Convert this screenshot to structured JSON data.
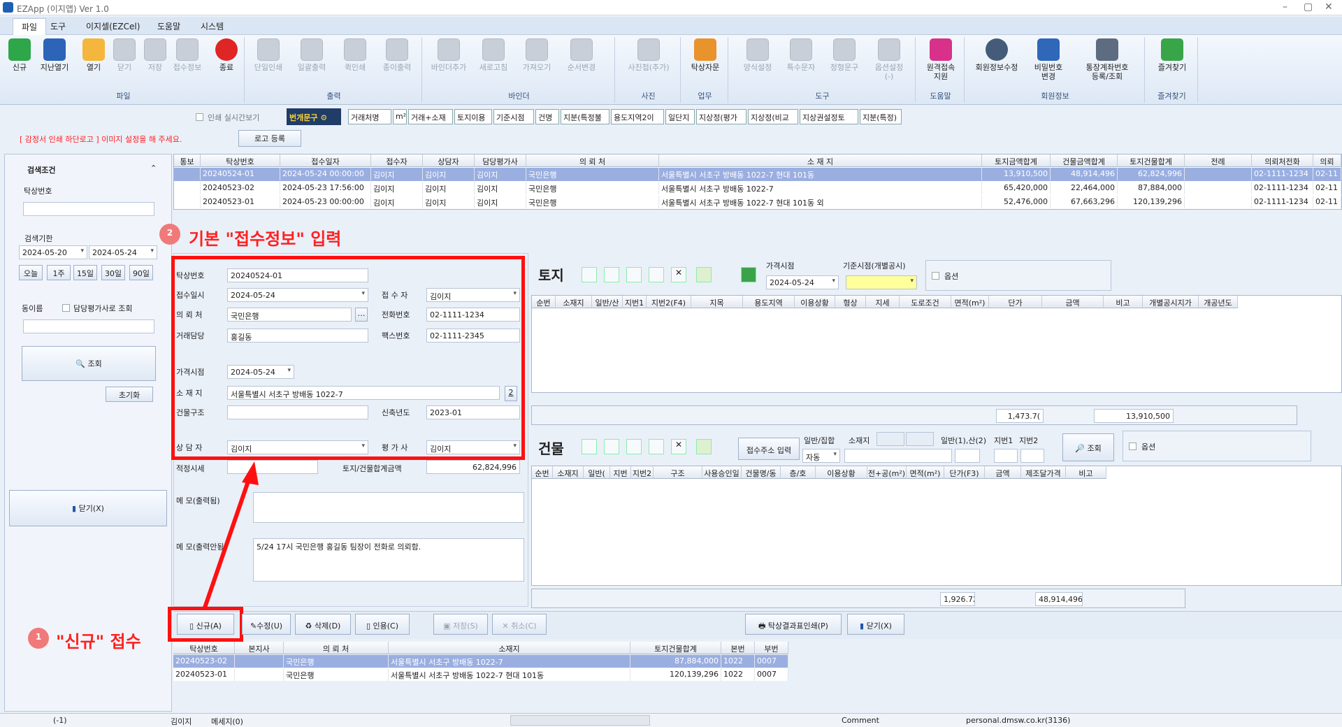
{
  "window": {
    "title": "EZApp (이지앱)  Ver 1.0"
  },
  "menu": {
    "tabs": [
      "파일",
      "도구",
      "이지셀(EZCel)",
      "도움말",
      "시스템"
    ]
  },
  "ribbon": {
    "file": {
      "label": "파일",
      "buttons": [
        "신규",
        "지난열기",
        "열기",
        "닫기",
        "저장",
        "접수정보",
        "종료"
      ]
    },
    "print": {
      "label": "출력",
      "buttons": [
        "단일인쇄",
        "일괄출력",
        "퀵인쇄",
        "종이출력"
      ]
    },
    "binder": {
      "label": "바인더",
      "buttons": [
        "바인더추가",
        "새로고침",
        "가져오기",
        "순서변경"
      ]
    },
    "photo": {
      "label": "사진",
      "buttons": [
        "사진첩(추가)"
      ]
    },
    "work": {
      "label": "업무",
      "buttons": [
        "탁상자문"
      ]
    },
    "tools": {
      "label": "도구",
      "buttons": [
        "양식설정",
        "특수문자",
        "정형문구",
        "옵션설정\n(-)"
      ]
    },
    "help": {
      "label": "도움말",
      "buttons": [
        "원격접속\n지원"
      ]
    },
    "member": {
      "label": "회원정보",
      "buttons": [
        "회원정보수정",
        "비밀번호\n변경",
        "통장계좌번호\n등록/조회"
      ]
    },
    "fav": {
      "label": "즐겨찾기",
      "buttons": [
        "즐겨찾기"
      ]
    }
  },
  "subbar": {
    "print_realtime": "인쇄 실시간보기",
    "phrase_btn": "번개문구",
    "chips": [
      "거래처명",
      "m²",
      "거래+소재",
      "토지이용",
      "기준시점",
      "건명",
      "지분(특정불",
      "용도지역2이",
      "일단지",
      "지상정(평가",
      "지상정(비교",
      "지상권설정토",
      "지분(특정)"
    ],
    "logo_warning": "[ 감정서 인쇄 하단로고 ] 이미지 설정을 해 주세요.",
    "logo_btn": "로고 등록"
  },
  "search": {
    "title": "검색조건",
    "id_label": "탁상번호",
    "period_label": "검색기한",
    "date_from": "2024-05-20",
    "date_to": "2024-05-24",
    "ranges": [
      "오늘",
      "1주",
      "15일",
      "30일",
      "90일"
    ],
    "name_label": "동이름",
    "check_label": "담당평가사로 조회",
    "search_btn": "조회",
    "reset_btn": "초기화",
    "close_btn": "닫기(X)"
  },
  "main_table": {
    "headers": [
      "통보",
      "탁상번호",
      "접수일자",
      "접수자",
      "상담자",
      "담당평가사",
      "의 뢰 처",
      "소 재 지",
      "토지금액합계",
      "건물금액합계",
      "토지건물합계",
      "전례",
      "의뢰처전화",
      "의뢰"
    ],
    "rows": [
      [
        "",
        "20240524-01",
        "2024-05-24 00:00:00",
        "김이지",
        "김이지",
        "김이지",
        "국민은행",
        "서울특별시 서초구 방배동 1022-7 현대 101동",
        "13,910,500",
        "48,914,496",
        "62,824,996",
        "",
        "02-1111-1234",
        "02-11"
      ],
      [
        "",
        "20240523-02",
        "2024-05-23 17:56:00",
        "김이지",
        "김이지",
        "김이지",
        "국민은행",
        "서울특별시 서초구 방배동 1022-7",
        "65,420,000",
        "22,464,000",
        "87,884,000",
        "",
        "02-1111-1234",
        "02-11"
      ],
      [
        "",
        "20240523-01",
        "2024-05-23 00:00:00",
        "김이지",
        "김이지",
        "김이지",
        "국민은행",
        "서울특별시 서초구 방배동 1022-7 현대 101동 외",
        "52,476,000",
        "67,663,296",
        "120,139,296",
        "",
        "02-1111-1234",
        "02-11"
      ]
    ]
  },
  "form": {
    "id_label": "탁상번호",
    "id": "20240524-01",
    "date_label": "접수일시",
    "date": "2024-05-24",
    "receiver_label": "접 수 자",
    "receiver": "김이지",
    "client_label": "의 뢰 처",
    "client": "국민은행",
    "tel_label": "전화번호",
    "tel": "02-1111-1234",
    "contact_label": "거래담당",
    "contact": "홍길동",
    "fax_label": "팩스번호",
    "fax": "02-1111-2345",
    "price_date_label": "가격시점",
    "price_date": "2024-05-24",
    "addr_label": "소 재 지",
    "addr": "서울특별시 서초구 방배동 1022-7",
    "addr_btn": "2",
    "struct_label": "건물구조",
    "year_label": "신축년도",
    "year": "2023-01",
    "consult_label": "상 담 자",
    "consult": "김이지",
    "appraiser_label": "평 가 사",
    "appraiser": "김이지",
    "est_label": "적정시세",
    "total_label": "토지/건물합계금액",
    "total": "62,824,996",
    "memo1_label": "메     모(출력됨)",
    "memo2_label": "메     모(출력안됨)",
    "memo2": "5/24 17시 국민은행 홍길동 팀장이 전화로 의뢰함."
  },
  "land": {
    "title": "토지",
    "price_date_label": "가격시점",
    "price_date": "2024-05-24",
    "base_label": "기준시점(개별공시)",
    "option": "옵션",
    "headers": [
      "순번",
      "소재지",
      "일반/산",
      "지번1",
      "지번2(F4)",
      "지목",
      "용도지역",
      "이용상황",
      "형상",
      "지세",
      "도로조건",
      "면적(m²)",
      "단가",
      "금액",
      "비고",
      "개별공시지가",
      "개공년도"
    ],
    "sum_area": "1,473.7(",
    "sum_amount": "13,910,500"
  },
  "building": {
    "title": "건물",
    "addr_btn": "접수주소 입력",
    "type_label": "일반/집합",
    "type": "자동",
    "loc_label": "소재지",
    "mount_label": "일반(1),산(2)",
    "no1_label": "지번1",
    "no2_label": "지번2",
    "search_btn": "조회",
    "option": "옵션",
    "headers": [
      "순번",
      "소재지",
      "일반(",
      "지번",
      "지번2",
      "구조",
      "사용승인일",
      "건물명/동",
      "층/호",
      "이용상황",
      "전+공(m²)",
      "면적(m²)",
      "단가(F3)",
      "금액",
      "제조달가격",
      "비고"
    ],
    "sum_area": "1,926.72",
    "sum_amount": "48,914,496"
  },
  "actions": {
    "new": "신규(A)",
    "edit": "수정(U)",
    "delete": "삭제(D)",
    "cite": "인용(C)",
    "save": "저장(S)",
    "cancel": "취소(C)",
    "print_result": "탁상결과표인쇄(P)",
    "close": "닫기(X)"
  },
  "sub_table": {
    "headers": [
      "탁상번호",
      "본지사",
      "의 뢰 처",
      "소재지",
      "토지건물합계",
      "본번",
      "부번"
    ],
    "rows": [
      [
        "20240523-02",
        "",
        "국민은행",
        "서울특별시 서초구 방배동 1022-7",
        "87,884,000",
        "1022",
        "0007"
      ],
      [
        "20240523-01",
        "",
        "국민은행",
        "서울특별시 서초구 방배동 1022-7 현대 101동",
        "120,139,296",
        "1022",
        "0007"
      ]
    ]
  },
  "annotations": {
    "step1_num": "1",
    "step1": "\"신규\" 접수",
    "step2_num": "2",
    "step2": "기본 \"접수정보\" 입력"
  },
  "status": {
    "a": "(-1)",
    "user": "김이지",
    "msg": "메세지(0)",
    "comment": "Comment",
    "site": "personal.dmsw.co.kr(3136)"
  }
}
